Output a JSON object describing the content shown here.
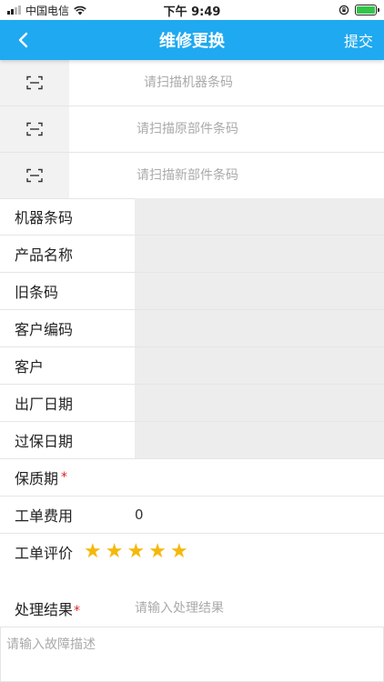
{
  "status_bar": {
    "carrier": "中国电信",
    "time": "下午 9:49"
  },
  "nav": {
    "title": "维修更换",
    "submit_label": "提交",
    "back_icon": "chevron-left-icon",
    "color": "#1fa9f0"
  },
  "scan_fields": [
    {
      "placeholder": "请扫描机器条码",
      "value": ""
    },
    {
      "placeholder": "请扫描原部件条码",
      "value": ""
    },
    {
      "placeholder": "请扫描新部件条码",
      "value": ""
    }
  ],
  "info_fields": [
    {
      "label": "机器条码",
      "value": ""
    },
    {
      "label": "产品名称",
      "value": ""
    },
    {
      "label": "旧条码",
      "value": ""
    },
    {
      "label": "客户编码",
      "value": ""
    },
    {
      "label": "客户",
      "value": ""
    },
    {
      "label": "出厂日期",
      "value": ""
    },
    {
      "label": "过保日期",
      "value": ""
    }
  ],
  "warranty": {
    "label": "保质期",
    "required_mark": "*",
    "value": ""
  },
  "fee": {
    "label": "工单费用",
    "value": "0"
  },
  "rating": {
    "label": "工单评价",
    "stars": 5,
    "max": 5,
    "color": "#f5b80c"
  },
  "result": {
    "label": "处理结果",
    "required_mark": "*",
    "placeholder": "请输入处理结果",
    "value": ""
  },
  "description": {
    "placeholder": "请输入故障描述",
    "value": ""
  }
}
